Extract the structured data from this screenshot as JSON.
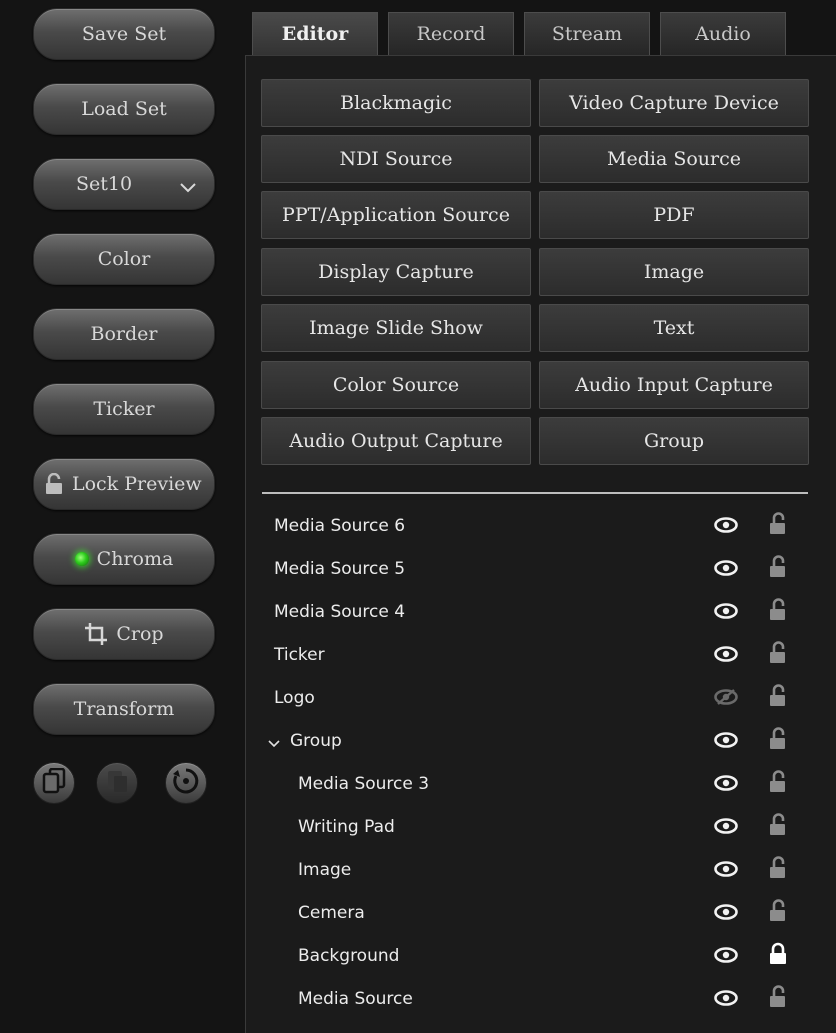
{
  "left_buttons": {
    "save_set": "Save Set",
    "load_set": "Load Set",
    "set_select": "Set10",
    "color": "Color",
    "border": "Border",
    "ticker": "Ticker",
    "lock_preview": "Lock Preview",
    "chroma": "Chroma",
    "crop": "Crop",
    "transform": "Transform"
  },
  "tabs": [
    {
      "label": "Editor",
      "active": true
    },
    {
      "label": "Record",
      "active": false
    },
    {
      "label": "Stream",
      "active": false
    },
    {
      "label": "Audio",
      "active": false
    }
  ],
  "sources": [
    "Blackmagic",
    "Video Capture Device",
    "NDI Source",
    "Media Source",
    "PPT/Application Source",
    "PDF",
    "Display Capture",
    "Image",
    "Image Slide Show",
    "Text",
    "Color Source",
    "Audio Input Capture",
    "Audio Output Capture",
    "Group"
  ],
  "layers": [
    {
      "name": "Media Source 6",
      "visible": true,
      "locked": false
    },
    {
      "name": "Media Source 5",
      "visible": true,
      "locked": false
    },
    {
      "name": "Media Source 4",
      "visible": true,
      "locked": false
    },
    {
      "name": "Ticker",
      "visible": true,
      "locked": false
    },
    {
      "name": "Logo",
      "visible": false,
      "locked": false
    },
    {
      "name": "Group",
      "visible": true,
      "locked": false,
      "expanded": true
    },
    {
      "name": "Media Source 3",
      "visible": true,
      "locked": false,
      "child": true
    },
    {
      "name": "Writing Pad",
      "visible": true,
      "locked": false,
      "child": true
    },
    {
      "name": "Image",
      "visible": true,
      "locked": false,
      "child": true
    },
    {
      "name": "Cemera",
      "visible": true,
      "locked": false,
      "child": true
    },
    {
      "name": "Background",
      "visible": true,
      "locked": true,
      "child": true
    },
    {
      "name": "Media Source",
      "visible": true,
      "locked": false,
      "child": true
    }
  ],
  "colors": {
    "background": "#141414",
    "chroma_led": "#2ecc1d"
  }
}
